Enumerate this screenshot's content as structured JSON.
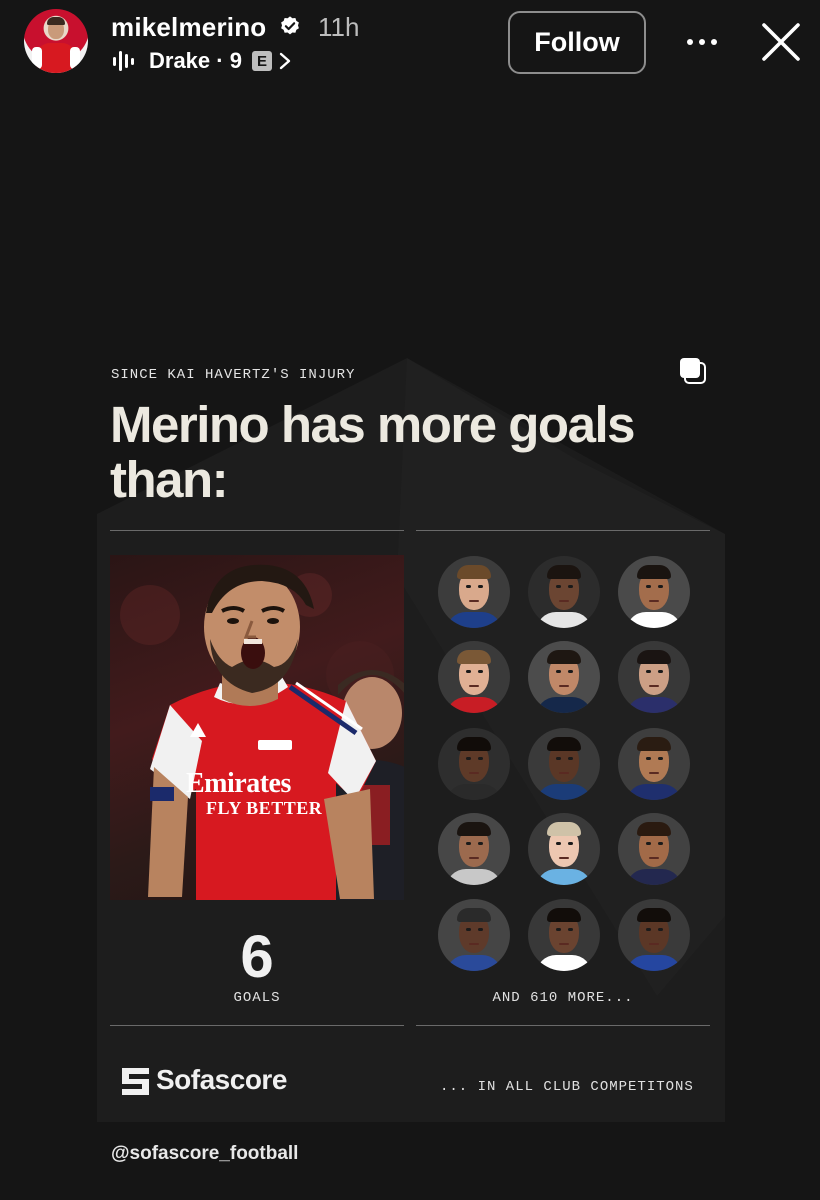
{
  "header": {
    "username": "mikelmerino",
    "age": "11h",
    "music": {
      "label": "Drake · 9",
      "explicit_badge": "E"
    },
    "follow_label": "Follow",
    "icons": [
      "verified-badge-icon",
      "equalizer-icon",
      "chevron-right-icon",
      "more-options-icon",
      "close-icon"
    ]
  },
  "card": {
    "eyebrow": "SINCE KAI HAVERTZ'S INJURY",
    "headline": "Merino has more goals than:",
    "player": {
      "shirt_sponsor_line1": "Emirates",
      "shirt_sponsor_line2": "FLY BETTER",
      "goals_value": "6",
      "goals_label": "GOALS"
    },
    "others": {
      "count_label": "AND 610 MORE...",
      "faces": [
        {
          "skin": "#d9a98c",
          "hair": "#6b4a2a",
          "kit": "#1e3f8a",
          "bg": "#3c3c3c"
        },
        {
          "skin": "#6b4532",
          "hair": "#1b1410",
          "kit": "#e6e6e6",
          "bg": "#2c2c2c"
        },
        {
          "skin": "#a36d4c",
          "hair": "#1a1410",
          "kit": "#ffffff",
          "bg": "#4a4a4a"
        },
        {
          "skin": "#e0b094",
          "hair": "#7a5836",
          "kit": "#c81d25",
          "bg": "#3a3a3a"
        },
        {
          "skin": "#c08868",
          "hair": "#1e1712",
          "kit": "#15284a",
          "bg": "#4c4c4c"
        },
        {
          "skin": "#cc9f85",
          "hair": "#1a1412",
          "kit": "#2b2f6b",
          "bg": "#383838"
        },
        {
          "skin": "#5e3a28",
          "hair": "#110c09",
          "kit": "#2a2a2a",
          "bg": "#2e2e2e"
        },
        {
          "skin": "#5a3726",
          "hair": "#120d0a",
          "kit": "#1b3c78",
          "bg": "#3a3a3a"
        },
        {
          "skin": "#b07a54",
          "hair": "#2a1c12",
          "kit": "#1f2f6e",
          "bg": "#3e3e3e"
        },
        {
          "skin": "#9c6a4e",
          "hair": "#1a1410",
          "kit": "#c8c8c8",
          "bg": "#474747"
        },
        {
          "skin": "#edc7b1",
          "hair": "#cfc2a8",
          "kit": "#6ab2e3",
          "bg": "#3a3a3a"
        },
        {
          "skin": "#a26a48",
          "hair": "#2a1a10",
          "kit": "#23284f",
          "bg": "#424242"
        },
        {
          "skin": "#5e3a2a",
          "hair": "#2a2a2a",
          "kit": "#2a4a9a",
          "bg": "#454545"
        },
        {
          "skin": "#6a4330",
          "hair": "#120d0a",
          "kit": "#ffffff",
          "bg": "#383838"
        },
        {
          "skin": "#5b3726",
          "hair": "#120d0a",
          "kit": "#2546a0",
          "bg": "#3a3a3a"
        }
      ]
    },
    "brand": "Sofascore",
    "scope_note": "... IN ALL CLUB COMPETITONS"
  },
  "mention": "@sofascore_football",
  "colors": {
    "background": "#151515",
    "card": "#1d1d1d",
    "headline": "#ece9e0",
    "arsenal_red": "#d71920"
  }
}
